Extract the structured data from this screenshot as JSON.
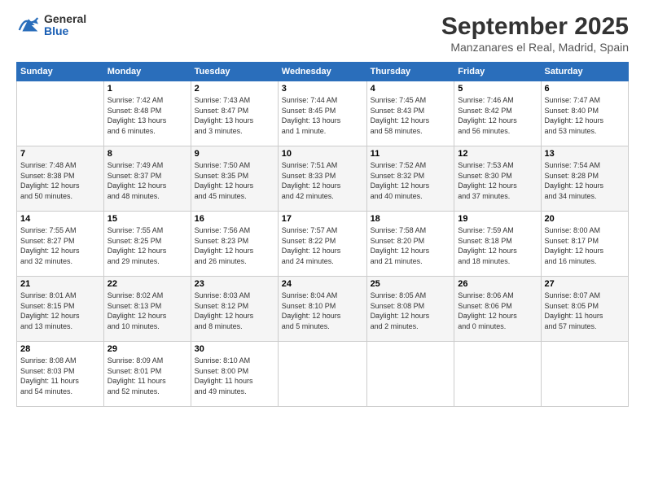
{
  "header": {
    "logo_line1": "General",
    "logo_line2": "Blue",
    "month_title": "September 2025",
    "location": "Manzanares el Real, Madrid, Spain"
  },
  "weekdays": [
    "Sunday",
    "Monday",
    "Tuesday",
    "Wednesday",
    "Thursday",
    "Friday",
    "Saturday"
  ],
  "weeks": [
    [
      {
        "day": "",
        "info": ""
      },
      {
        "day": "1",
        "info": "Sunrise: 7:42 AM\nSunset: 8:48 PM\nDaylight: 13 hours\nand 6 minutes."
      },
      {
        "day": "2",
        "info": "Sunrise: 7:43 AM\nSunset: 8:47 PM\nDaylight: 13 hours\nand 3 minutes."
      },
      {
        "day": "3",
        "info": "Sunrise: 7:44 AM\nSunset: 8:45 PM\nDaylight: 13 hours\nand 1 minute."
      },
      {
        "day": "4",
        "info": "Sunrise: 7:45 AM\nSunset: 8:43 PM\nDaylight: 12 hours\nand 58 minutes."
      },
      {
        "day": "5",
        "info": "Sunrise: 7:46 AM\nSunset: 8:42 PM\nDaylight: 12 hours\nand 56 minutes."
      },
      {
        "day": "6",
        "info": "Sunrise: 7:47 AM\nSunset: 8:40 PM\nDaylight: 12 hours\nand 53 minutes."
      }
    ],
    [
      {
        "day": "7",
        "info": "Sunrise: 7:48 AM\nSunset: 8:38 PM\nDaylight: 12 hours\nand 50 minutes."
      },
      {
        "day": "8",
        "info": "Sunrise: 7:49 AM\nSunset: 8:37 PM\nDaylight: 12 hours\nand 48 minutes."
      },
      {
        "day": "9",
        "info": "Sunrise: 7:50 AM\nSunset: 8:35 PM\nDaylight: 12 hours\nand 45 minutes."
      },
      {
        "day": "10",
        "info": "Sunrise: 7:51 AM\nSunset: 8:33 PM\nDaylight: 12 hours\nand 42 minutes."
      },
      {
        "day": "11",
        "info": "Sunrise: 7:52 AM\nSunset: 8:32 PM\nDaylight: 12 hours\nand 40 minutes."
      },
      {
        "day": "12",
        "info": "Sunrise: 7:53 AM\nSunset: 8:30 PM\nDaylight: 12 hours\nand 37 minutes."
      },
      {
        "day": "13",
        "info": "Sunrise: 7:54 AM\nSunset: 8:28 PM\nDaylight: 12 hours\nand 34 minutes."
      }
    ],
    [
      {
        "day": "14",
        "info": "Sunrise: 7:55 AM\nSunset: 8:27 PM\nDaylight: 12 hours\nand 32 minutes."
      },
      {
        "day": "15",
        "info": "Sunrise: 7:55 AM\nSunset: 8:25 PM\nDaylight: 12 hours\nand 29 minutes."
      },
      {
        "day": "16",
        "info": "Sunrise: 7:56 AM\nSunset: 8:23 PM\nDaylight: 12 hours\nand 26 minutes."
      },
      {
        "day": "17",
        "info": "Sunrise: 7:57 AM\nSunset: 8:22 PM\nDaylight: 12 hours\nand 24 minutes."
      },
      {
        "day": "18",
        "info": "Sunrise: 7:58 AM\nSunset: 8:20 PM\nDaylight: 12 hours\nand 21 minutes."
      },
      {
        "day": "19",
        "info": "Sunrise: 7:59 AM\nSunset: 8:18 PM\nDaylight: 12 hours\nand 18 minutes."
      },
      {
        "day": "20",
        "info": "Sunrise: 8:00 AM\nSunset: 8:17 PM\nDaylight: 12 hours\nand 16 minutes."
      }
    ],
    [
      {
        "day": "21",
        "info": "Sunrise: 8:01 AM\nSunset: 8:15 PM\nDaylight: 12 hours\nand 13 minutes."
      },
      {
        "day": "22",
        "info": "Sunrise: 8:02 AM\nSunset: 8:13 PM\nDaylight: 12 hours\nand 10 minutes."
      },
      {
        "day": "23",
        "info": "Sunrise: 8:03 AM\nSunset: 8:12 PM\nDaylight: 12 hours\nand 8 minutes."
      },
      {
        "day": "24",
        "info": "Sunrise: 8:04 AM\nSunset: 8:10 PM\nDaylight: 12 hours\nand 5 minutes."
      },
      {
        "day": "25",
        "info": "Sunrise: 8:05 AM\nSunset: 8:08 PM\nDaylight: 12 hours\nand 2 minutes."
      },
      {
        "day": "26",
        "info": "Sunrise: 8:06 AM\nSunset: 8:06 PM\nDaylight: 12 hours\nand 0 minutes."
      },
      {
        "day": "27",
        "info": "Sunrise: 8:07 AM\nSunset: 8:05 PM\nDaylight: 11 hours\nand 57 minutes."
      }
    ],
    [
      {
        "day": "28",
        "info": "Sunrise: 8:08 AM\nSunset: 8:03 PM\nDaylight: 11 hours\nand 54 minutes."
      },
      {
        "day": "29",
        "info": "Sunrise: 8:09 AM\nSunset: 8:01 PM\nDaylight: 11 hours\nand 52 minutes."
      },
      {
        "day": "30",
        "info": "Sunrise: 8:10 AM\nSunset: 8:00 PM\nDaylight: 11 hours\nand 49 minutes."
      },
      {
        "day": "",
        "info": ""
      },
      {
        "day": "",
        "info": ""
      },
      {
        "day": "",
        "info": ""
      },
      {
        "day": "",
        "info": ""
      }
    ]
  ]
}
